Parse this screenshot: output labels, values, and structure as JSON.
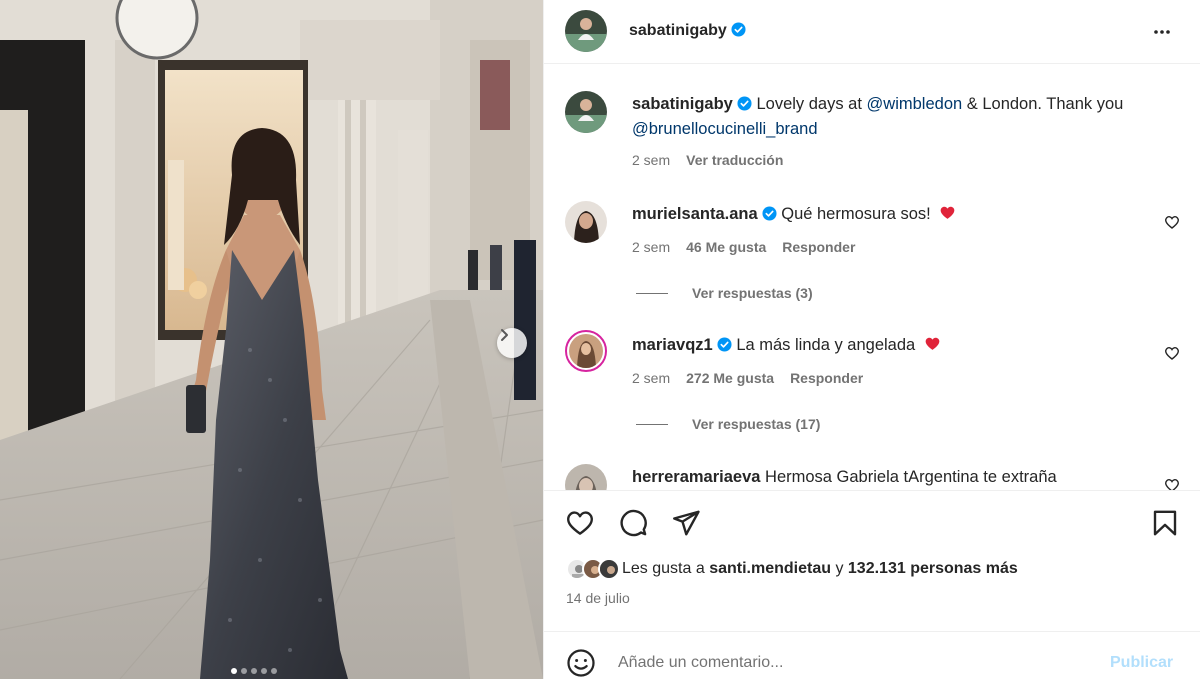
{
  "post": {
    "username": "sabatinigaby",
    "verified": true
  },
  "caption": {
    "username": "sabatinigaby",
    "text_before": "Lovely days at",
    "mention1": "@wimbledon",
    "text_mid": "& London. Thank you",
    "mention2": "@brunellocucinelli_brand",
    "time": "2 sem",
    "translate": "Ver traducción"
  },
  "comments": [
    {
      "username": "murielsanta.ana",
      "text": "Qué hermosura sos!",
      "emoji": "red-heart",
      "time": "2 sem",
      "likes": "46 Me gusta",
      "reply": "Responder",
      "replies": "Ver respuestas (3)"
    },
    {
      "username": "mariavqz1",
      "text": "La más linda y angelada",
      "emoji": "red-heart",
      "time": "2 sem",
      "likes": "272 Me gusta",
      "reply": "Responder",
      "replies": "Ver respuestas (17)"
    },
    {
      "username": "herreramariaeva",
      "text": "Hermosa Gabriela tArgentina te extraña"
    }
  ],
  "liked_by": {
    "prefix": "Les gusta a",
    "user": "santi.mendietau",
    "conj": "y",
    "others": "132.131 personas más"
  },
  "date": "14 de julio",
  "add_comment": {
    "placeholder": "Añade un comentario...",
    "publish": "Publicar"
  },
  "carousel": {
    "slide_count": 5,
    "active_slide": 1
  },
  "colors": {
    "accent": "#0095f6",
    "verified": "#0095f6",
    "heart": "#ff3040",
    "muted": "#737373",
    "link": "#00376b"
  }
}
